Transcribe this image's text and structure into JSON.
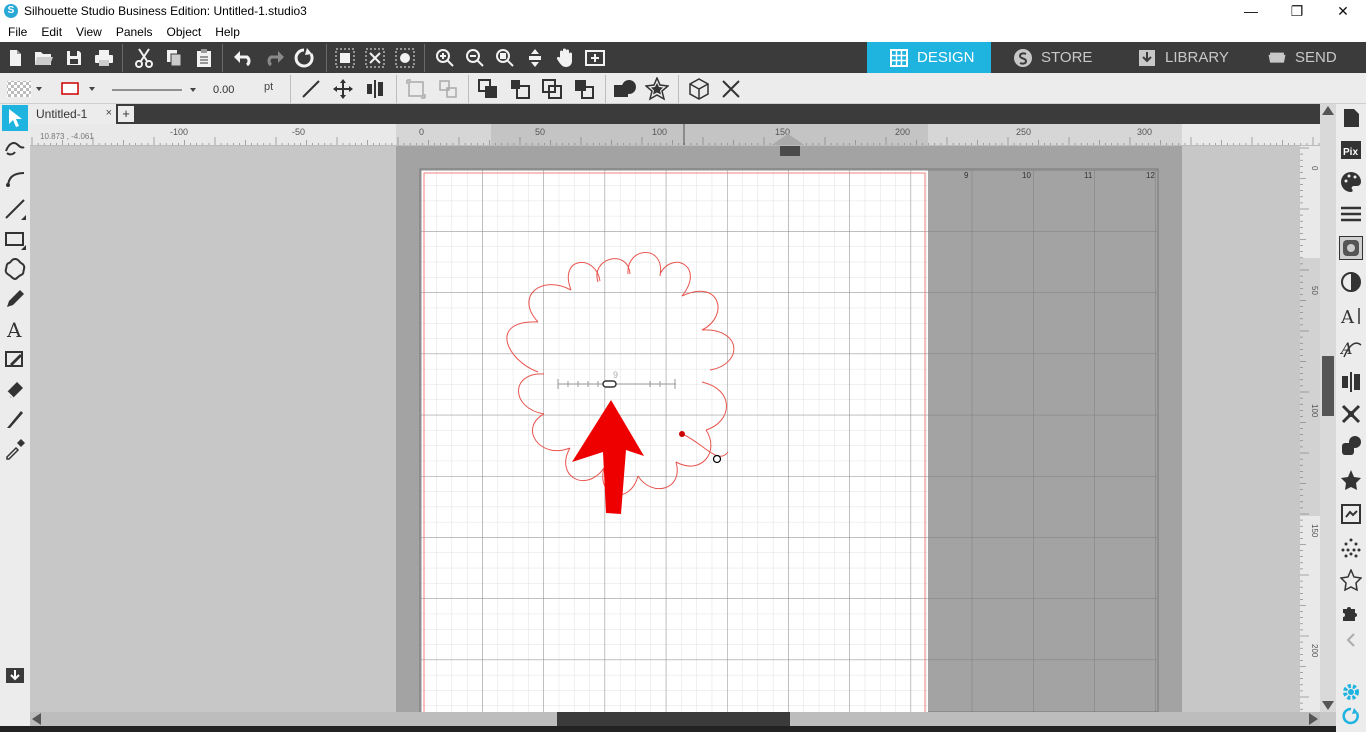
{
  "window": {
    "title": "Silhouette Studio Business Edition: Untitled-1.studio3",
    "controls": {
      "minimize": "—",
      "restore": "❐",
      "close": "✕"
    }
  },
  "menu": [
    "File",
    "Edit",
    "View",
    "Panels",
    "Object",
    "Help"
  ],
  "nav_tabs": [
    {
      "label": "DESIGN",
      "icon": "grid-icon",
      "active": true
    },
    {
      "label": "STORE",
      "icon": "silhouette-s-icon",
      "active": false
    },
    {
      "label": "LIBRARY",
      "icon": "download-box-icon",
      "active": false
    },
    {
      "label": "SEND",
      "icon": "cutter-icon",
      "active": false
    }
  ],
  "line_style": {
    "thickness": "0.00",
    "unit": "pt"
  },
  "document": {
    "tab_label": "Untitled-1",
    "close_glyph": "×",
    "add_glyph": "+"
  },
  "rulers": {
    "coordinates": "10.873 , -4.061",
    "h_labels": [
      "-100",
      "-50",
      "0",
      "50",
      "100",
      "150",
      "200",
      "250",
      "300"
    ],
    "v_labels": [
      "0",
      "50",
      "100",
      "150",
      "200"
    ],
    "mat_labels": [
      "9",
      "10",
      "11",
      "12"
    ]
  },
  "knife_handle_label": "9",
  "colors": {
    "accent": "#1fb3e0",
    "toolbar_dark": "#3b3b3b",
    "cut_line": "#e8554f",
    "arrow": "#ee0000",
    "mat_gray": "#a3a3a3"
  }
}
